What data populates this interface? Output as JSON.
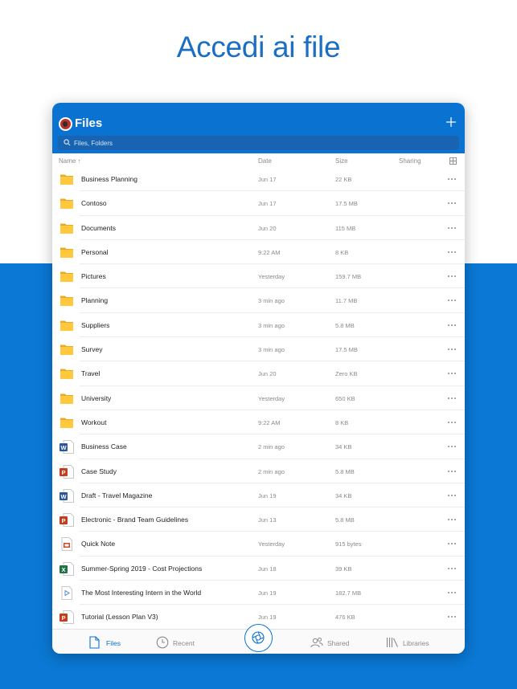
{
  "headline": "Accedi ai file",
  "appbar": {
    "title": "Files"
  },
  "search": {
    "placeholder": "Files, Folders"
  },
  "columns": {
    "name": "Name ↑",
    "date": "Date",
    "size": "Size",
    "sharing": "Sharing"
  },
  "files": [
    {
      "name": "Business Planning",
      "date": "Jun 17",
      "size": "22 KB",
      "type": "folder"
    },
    {
      "name": "Contoso",
      "date": "Jun 17",
      "size": "17.5 MB",
      "type": "folder"
    },
    {
      "name": "Documents",
      "date": "Jun 20",
      "size": "115 MB",
      "type": "folder"
    },
    {
      "name": "Personal",
      "date": "9:22 AM",
      "size": "8 KB",
      "type": "folder"
    },
    {
      "name": "Pictures",
      "date": "Yesterday",
      "size": "159.7 MB",
      "type": "folder"
    },
    {
      "name": "Planning",
      "date": "3 min ago",
      "size": "11.7 MB",
      "type": "folder"
    },
    {
      "name": "Suppliers",
      "date": "3 min ago",
      "size": "5.8 MB",
      "type": "folder"
    },
    {
      "name": "Survey",
      "date": "3 min ago",
      "size": "17.5 MB",
      "type": "folder"
    },
    {
      "name": "Travel",
      "date": "Jun 20",
      "size": "Zero KB",
      "type": "folder"
    },
    {
      "name": "University",
      "date": "Yesterday",
      "size": "650 KB",
      "type": "folder"
    },
    {
      "name": "Workout",
      "date": "9:22 AM",
      "size": "8 KB",
      "type": "folder"
    },
    {
      "name": "Business Case",
      "date": "2 min ago",
      "size": "34 KB",
      "type": "word"
    },
    {
      "name": "Case Study",
      "date": "2 min ago",
      "size": "5.8 MB",
      "type": "powerpoint"
    },
    {
      "name": "Draft - Travel Magazine",
      "date": "Jun 19",
      "size": "34 KB",
      "type": "word"
    },
    {
      "name": "Electronic - Brand Team Guidelines",
      "date": "Jun 13",
      "size": "5.8 MB",
      "type": "powerpoint"
    },
    {
      "name": "Quick Note",
      "date": "Yesterday",
      "size": "915 bytes",
      "type": "pdf"
    },
    {
      "name": "Summer-Spring 2019 - Cost Projections",
      "date": "Jun 18",
      "size": "39 KB",
      "type": "excel"
    },
    {
      "name": "The Most Interesting Intern in the World",
      "date": "Jun 19",
      "size": "182.7 MB",
      "type": "video"
    },
    {
      "name": "Tutorial (Lesson Plan V3)",
      "date": "Jun 19",
      "size": "476 KB",
      "type": "powerpoint"
    }
  ],
  "tabs": {
    "files": "Files",
    "recent": "Recent",
    "shared": "Shared",
    "libraries": "Libraries"
  },
  "colors": {
    "brand": "#0a72d1",
    "folder": "#ffc83d",
    "word": "#2b579a",
    "powerpoint": "#c43e1c",
    "excel": "#217346"
  }
}
